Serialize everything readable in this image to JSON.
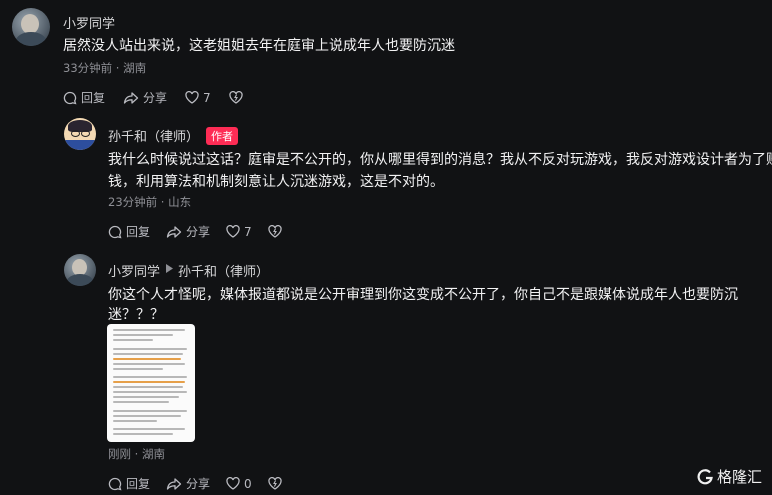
{
  "comments": [
    {
      "user": "小罗同学",
      "text": "居然没人站出来说，这老姐姐去年在庭审上说成年人也要防沉迷",
      "meta": "33分钟前 · 湖南",
      "reply_label": "回复",
      "share_label": "分享",
      "like_count": "7"
    },
    {
      "user": "孙千和（律师）",
      "badge": "作者",
      "text_line1": "我什么时候说过这话？庭审是不公开的，你从哪里得到的消息？我从不反对玩游戏，我反对游戏设计者为了赚",
      "text_line2": "钱，利用算法和机制刻意让人沉迷游戏，这是不对的。",
      "meta": "23分钟前 · 山东",
      "reply_label": "回复",
      "share_label": "分享",
      "like_count": "7"
    },
    {
      "user": "小罗同学",
      "reply_to": "孙千和（律师）",
      "text_line1": "你这个人才怪呢，媒体报道都说是公开审理到你这变成不公开了，你自己不是跟媒体说成年人也要防沉",
      "text_line2": "迷？？？",
      "meta": "刚刚 · 湖南",
      "reply_label": "回复",
      "share_label": "分享",
      "like_count": "0"
    }
  ],
  "watermark": "格隆汇",
  "colors": {
    "background": "#111214",
    "author_badge": "#fe2c55",
    "meta": "#8f9096"
  },
  "icons": [
    "comment-icon",
    "share-icon",
    "heart-icon",
    "dislike-heart-icon",
    "caret-right-icon",
    "gelonghui-logo-icon"
  ]
}
